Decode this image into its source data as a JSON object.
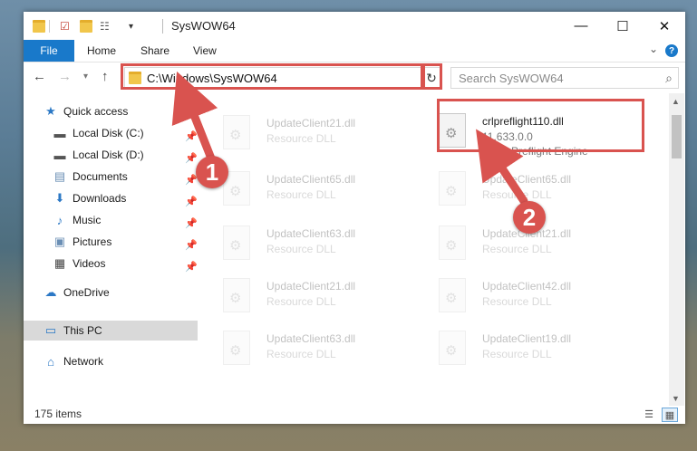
{
  "window": {
    "title": "SysWOW64"
  },
  "ribbon": {
    "tabs": [
      "File",
      "Home",
      "Share",
      "View"
    ],
    "help": "?"
  },
  "nav": {
    "address": "C:\\Windows\\SysWOW64",
    "search_placeholder": "Search SysWOW64"
  },
  "sidebar": {
    "items": [
      {
        "label": "Quick access",
        "icon": "star-icon"
      },
      {
        "label": "Local Disk (C:)",
        "icon": "drive-icon"
      },
      {
        "label": "Local Disk (D:)",
        "icon": "drive-icon"
      },
      {
        "label": "Documents",
        "icon": "documents-icon"
      },
      {
        "label": "Downloads",
        "icon": "download-icon"
      },
      {
        "label": "Music",
        "icon": "music-icon"
      },
      {
        "label": "Pictures",
        "icon": "pictures-icon"
      },
      {
        "label": "Videos",
        "icon": "videos-icon"
      },
      {
        "label": "OneDrive",
        "icon": "cloud-icon"
      },
      {
        "label": "This PC",
        "icon": "computer-icon"
      },
      {
        "label": "Network",
        "icon": "network-icon"
      }
    ]
  },
  "files": {
    "left": [
      {
        "name": "UpdateClient21.dll",
        "type": "Resource DLL"
      },
      {
        "name": "UpdateClient65.dll",
        "type": "Resource DLL"
      },
      {
        "name": "UpdateClient63.dll",
        "type": "Resource DLL"
      },
      {
        "name": "UpdateClient21.dll",
        "type": "Resource DLL"
      },
      {
        "name": "UpdateClient63.dll",
        "type": "Resource DLL"
      }
    ],
    "highlighted": {
      "name": "crlpreflight110.dll",
      "version": "11.633.0.0",
      "description": "Corel Preflight Engine"
    },
    "right": [
      {
        "name": "UpdateClient65.dll",
        "type": "Resource DLL"
      },
      {
        "name": "UpdateClient21.dll",
        "type": "Resource DLL"
      },
      {
        "name": "UpdateClient42.dll",
        "type": "Resource DLL"
      },
      {
        "name": "UpdateClient19.dll",
        "type": "Resource DLL"
      }
    ]
  },
  "status": {
    "items": "175 items"
  },
  "annotations": {
    "badge1": "1",
    "badge2": "2",
    "color": "#d9534f"
  }
}
